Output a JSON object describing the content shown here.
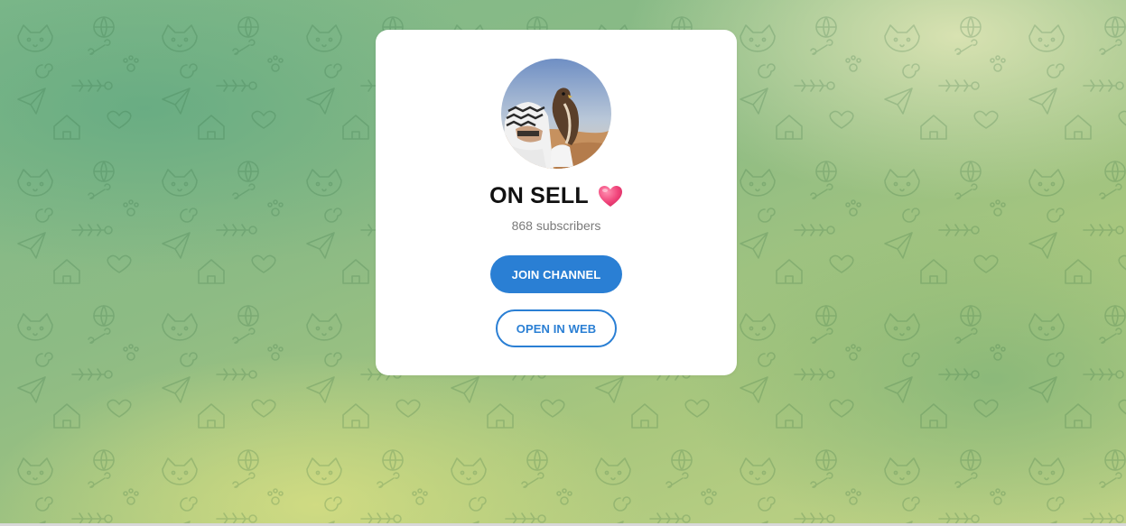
{
  "channel": {
    "name": "ON SELL",
    "emoji": "heart-icon",
    "subscribers": "868 subscribers"
  },
  "actions": {
    "join_label": "JOIN CHANNEL",
    "web_label": "OPEN IN WEB"
  },
  "colors": {
    "accent": "#2a7fd4",
    "heart": "#e8336d",
    "card": "#ffffff"
  },
  "icons": {
    "avatar": "channel-avatar",
    "background": "doodle-pattern"
  }
}
